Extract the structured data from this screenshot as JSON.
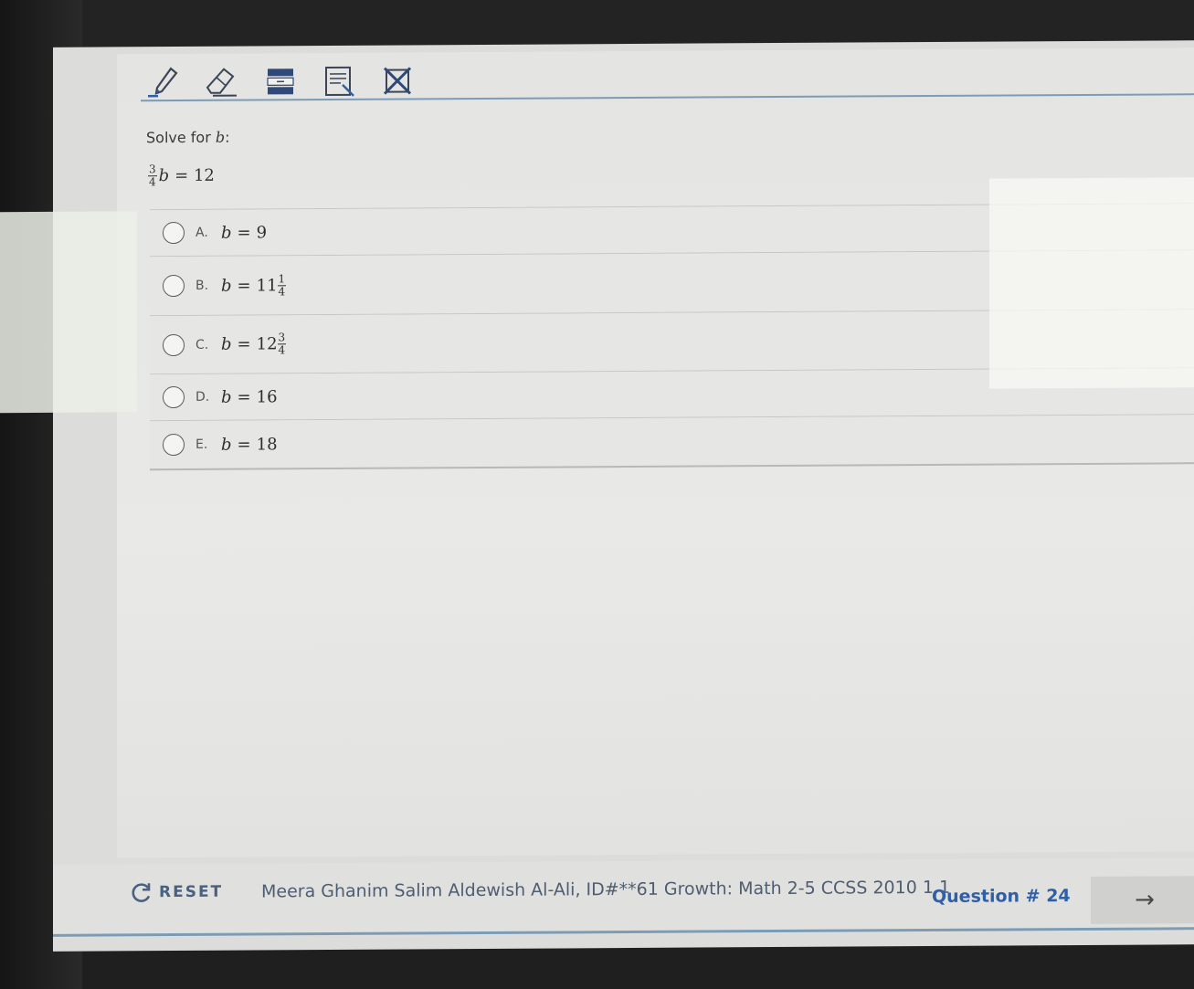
{
  "toolbar": {
    "tools": [
      {
        "icon": "pencil-icon"
      },
      {
        "icon": "eraser-icon"
      },
      {
        "icon": "line-reader-icon"
      },
      {
        "icon": "notepad-icon"
      },
      {
        "icon": "answer-eliminator-icon"
      }
    ]
  },
  "question": {
    "prompt_text": "Solve for ",
    "prompt_var": "b",
    "prompt_suffix": ":",
    "equation": {
      "numerator": "3",
      "denominator": "4",
      "variable": "b",
      "rhs": "= 12"
    }
  },
  "choices": [
    {
      "letter": "A.",
      "var": "b",
      "eq": "=",
      "whole": "9",
      "num": "",
      "den": ""
    },
    {
      "letter": "B.",
      "var": "b",
      "eq": "=",
      "whole": "11",
      "num": "1",
      "den": "4"
    },
    {
      "letter": "C.",
      "var": "b",
      "eq": "=",
      "whole": "12",
      "num": "3",
      "den": "4"
    },
    {
      "letter": "D.",
      "var": "b",
      "eq": "=",
      "whole": "16",
      "num": "",
      "den": ""
    },
    {
      "letter": "E.",
      "var": "b",
      "eq": "=",
      "whole": "18",
      "num": "",
      "den": ""
    }
  ],
  "footer": {
    "reset_label": "RESET",
    "student_info": "Meera Ghanim Salim Aldewish Al-Ali, ID#**61 Growth: Math 2-5 CCSS 2010 1.1",
    "question_number": "Question # 24",
    "next_arrow": "→"
  },
  "colors": {
    "accent": "#2f5fa6",
    "rule": "#7c9cb6"
  }
}
